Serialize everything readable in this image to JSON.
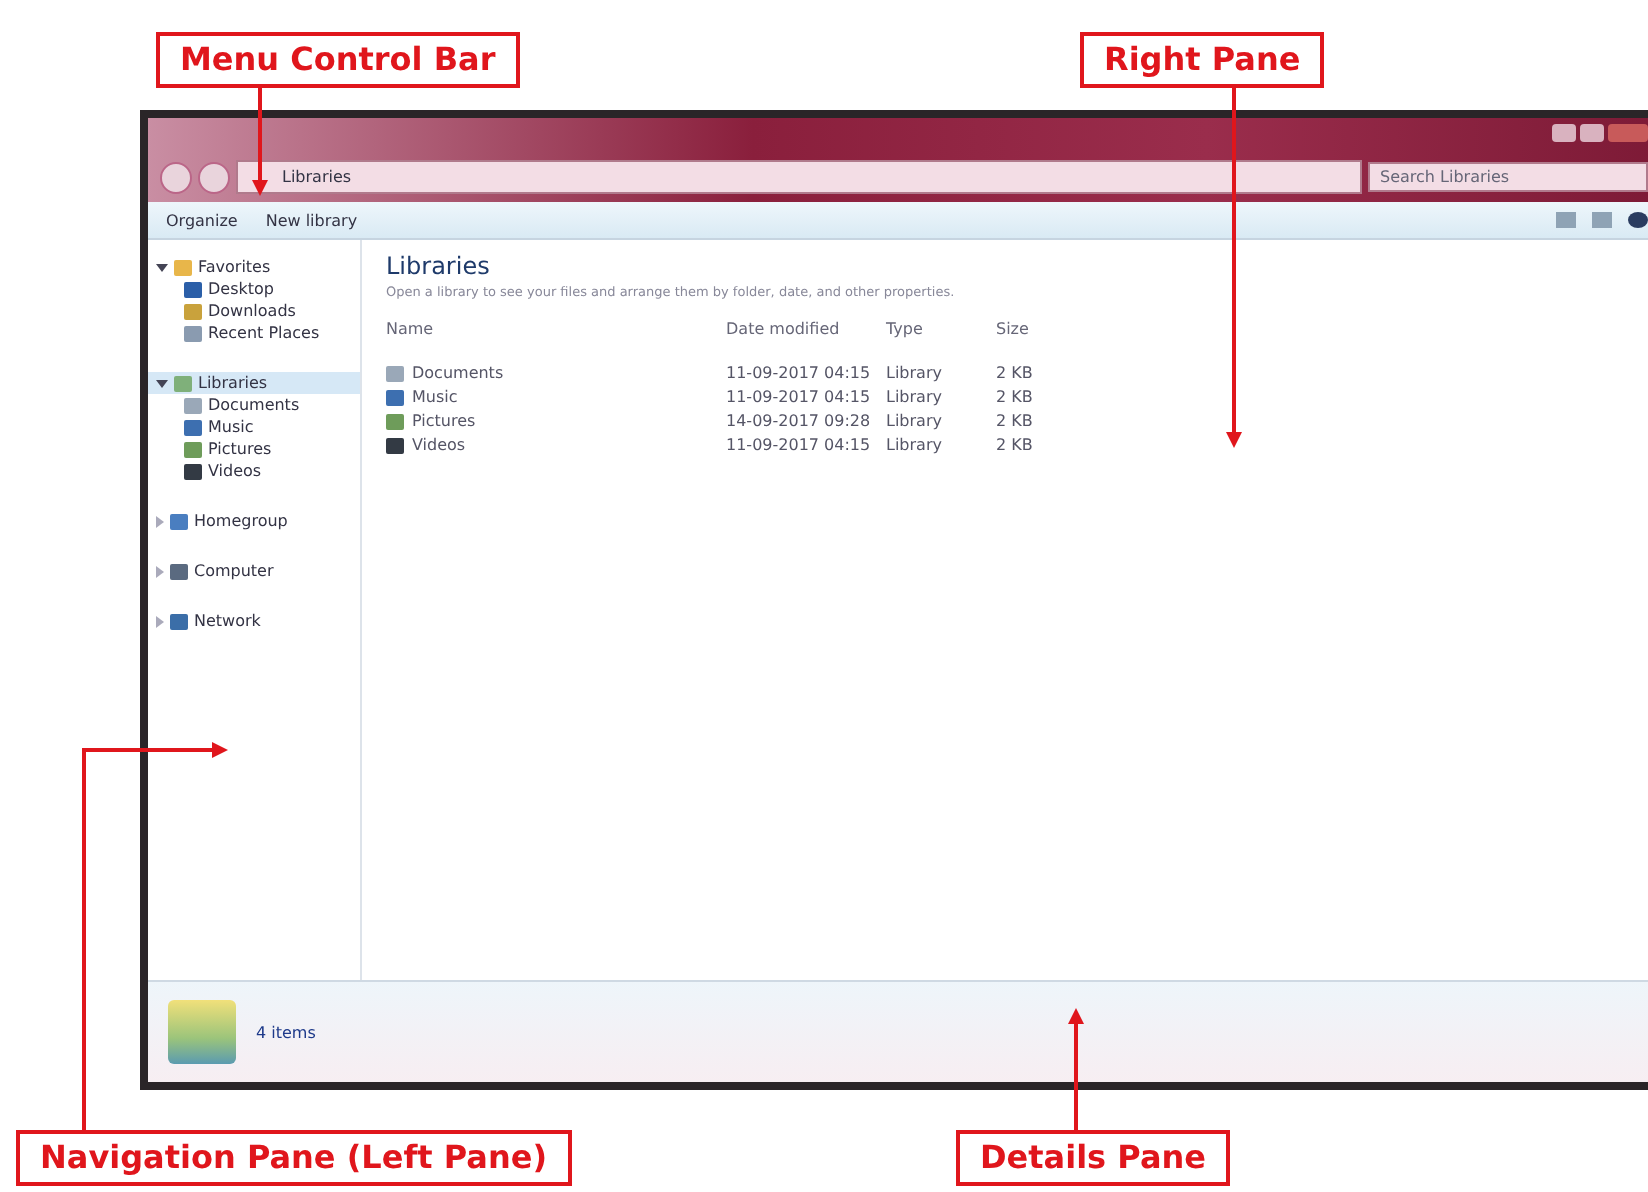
{
  "callouts": [
    {
      "label": "Menu Control Bar"
    },
    {
      "label": "Right Pane"
    },
    {
      "label": "Navigation Pane (Left Pane)"
    },
    {
      "label": "Details Pane"
    }
  ],
  "window": {
    "address": {
      "path": "Libraries"
    },
    "search": {
      "placeholder": "Search Libraries"
    },
    "toolbar": {
      "buttons": [
        "Organize",
        "New library"
      ]
    },
    "navigation": [
      {
        "label": "Favorites",
        "kind": "star",
        "expanded": true,
        "selected": false,
        "children": [
          {
            "label": "Desktop",
            "kind": "desktop",
            "selected": false
          },
          {
            "label": "Downloads",
            "kind": "download",
            "selected": false
          },
          {
            "label": "Recent Places",
            "kind": "recent",
            "selected": false
          }
        ]
      },
      {
        "label": "Libraries",
        "kind": "library",
        "expanded": true,
        "selected": true,
        "children": [
          {
            "label": "Documents",
            "kind": "document",
            "selected": false
          },
          {
            "label": "Music",
            "kind": "music",
            "selected": false
          },
          {
            "label": "Pictures",
            "kind": "picture",
            "selected": false
          },
          {
            "label": "Videos",
            "kind": "video",
            "selected": false
          }
        ]
      },
      {
        "label": "Homegroup",
        "kind": "homegroup",
        "expanded": false,
        "selected": false
      },
      {
        "label": "Computer",
        "kind": "computer",
        "expanded": false,
        "selected": false
      },
      {
        "label": "Network",
        "kind": "network",
        "expanded": false,
        "selected": false
      }
    ],
    "content": {
      "title": "Libraries",
      "subtitle": "Open a library to see your files and arrange them by folder, date, and other properties.",
      "columns": [
        "Name",
        "Date modified",
        "Type",
        "Size"
      ],
      "rows": [
        {
          "kind": "document",
          "cells": [
            "Documents",
            "11-09-2017 04:15",
            "Library",
            "2 KB"
          ]
        },
        {
          "kind": "music",
          "cells": [
            "Music",
            "11-09-2017 04:15",
            "Library",
            "2 KB"
          ]
        },
        {
          "kind": "picture",
          "cells": [
            "Pictures",
            "14-09-2017 09:28",
            "Library",
            "2 KB"
          ]
        },
        {
          "kind": "video",
          "cells": [
            "Videos",
            "11-09-2017 04:15",
            "Library",
            "2 KB"
          ]
        }
      ]
    },
    "details": {
      "text": "4 items"
    }
  }
}
